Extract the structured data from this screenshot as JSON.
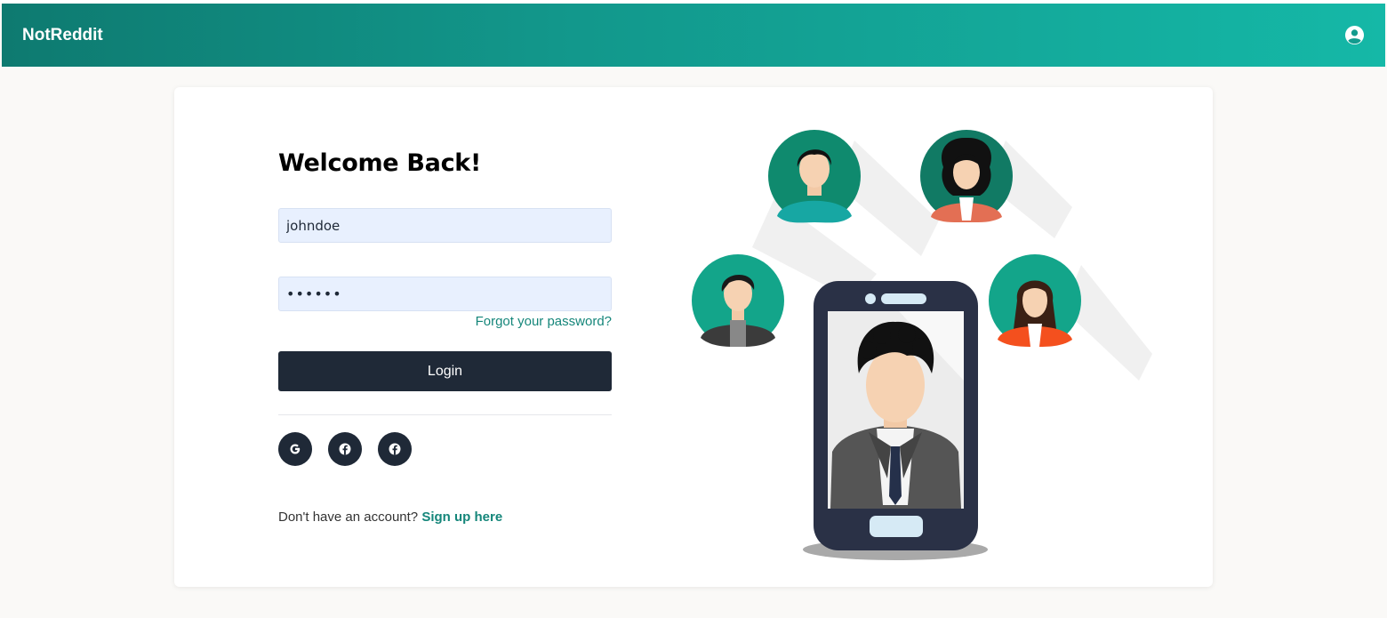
{
  "navbar": {
    "brand": "NotReddit",
    "account_icon": "user-circle-icon"
  },
  "login": {
    "title": "Welcome Back!",
    "username_value": "johndoe",
    "password_value": "••••••",
    "forgot_label": "Forgot your password?",
    "login_label": "Login",
    "social": [
      {
        "icon": "google-icon"
      },
      {
        "icon": "facebook-icon"
      },
      {
        "icon": "facebook-icon"
      }
    ],
    "signup_prompt": "Don't have an account?",
    "signup_link": "Sign up here"
  },
  "colors": {
    "accent": "#15867a",
    "navbar_start": "#0e7a70",
    "navbar_end": "#15b8a7",
    "button": "#1f2937",
    "input_bg": "#e8f0fe"
  }
}
